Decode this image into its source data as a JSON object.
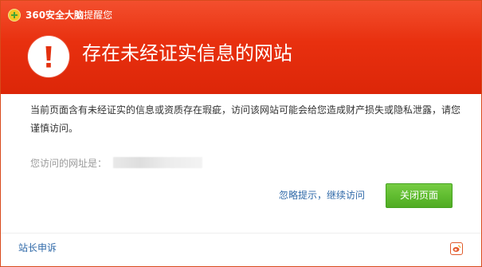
{
  "header": {
    "brand_main": "360安全大脑",
    "brand_sub": "提醒您",
    "title": "存在未经证实信息的网站"
  },
  "body": {
    "message": "当前页面含有未经证实的信息或资质存在瑕疵，访问该网站可能会给您造成财产损失或隐私泄露，请您谨慎访问。",
    "url_label": "您访问的网址是："
  },
  "actions": {
    "ignore_label": "忽略提示，继续访问",
    "close_label": "关闭页面"
  },
  "footer": {
    "appeal_label": "站长申诉"
  },
  "icons": {
    "brand": "360-logo-icon",
    "alert": "exclamation-icon",
    "share": "weibo-icon"
  },
  "colors": {
    "header_red": "#e8300f",
    "button_green": "#5fbb2f",
    "link_blue": "#2f69a8"
  }
}
